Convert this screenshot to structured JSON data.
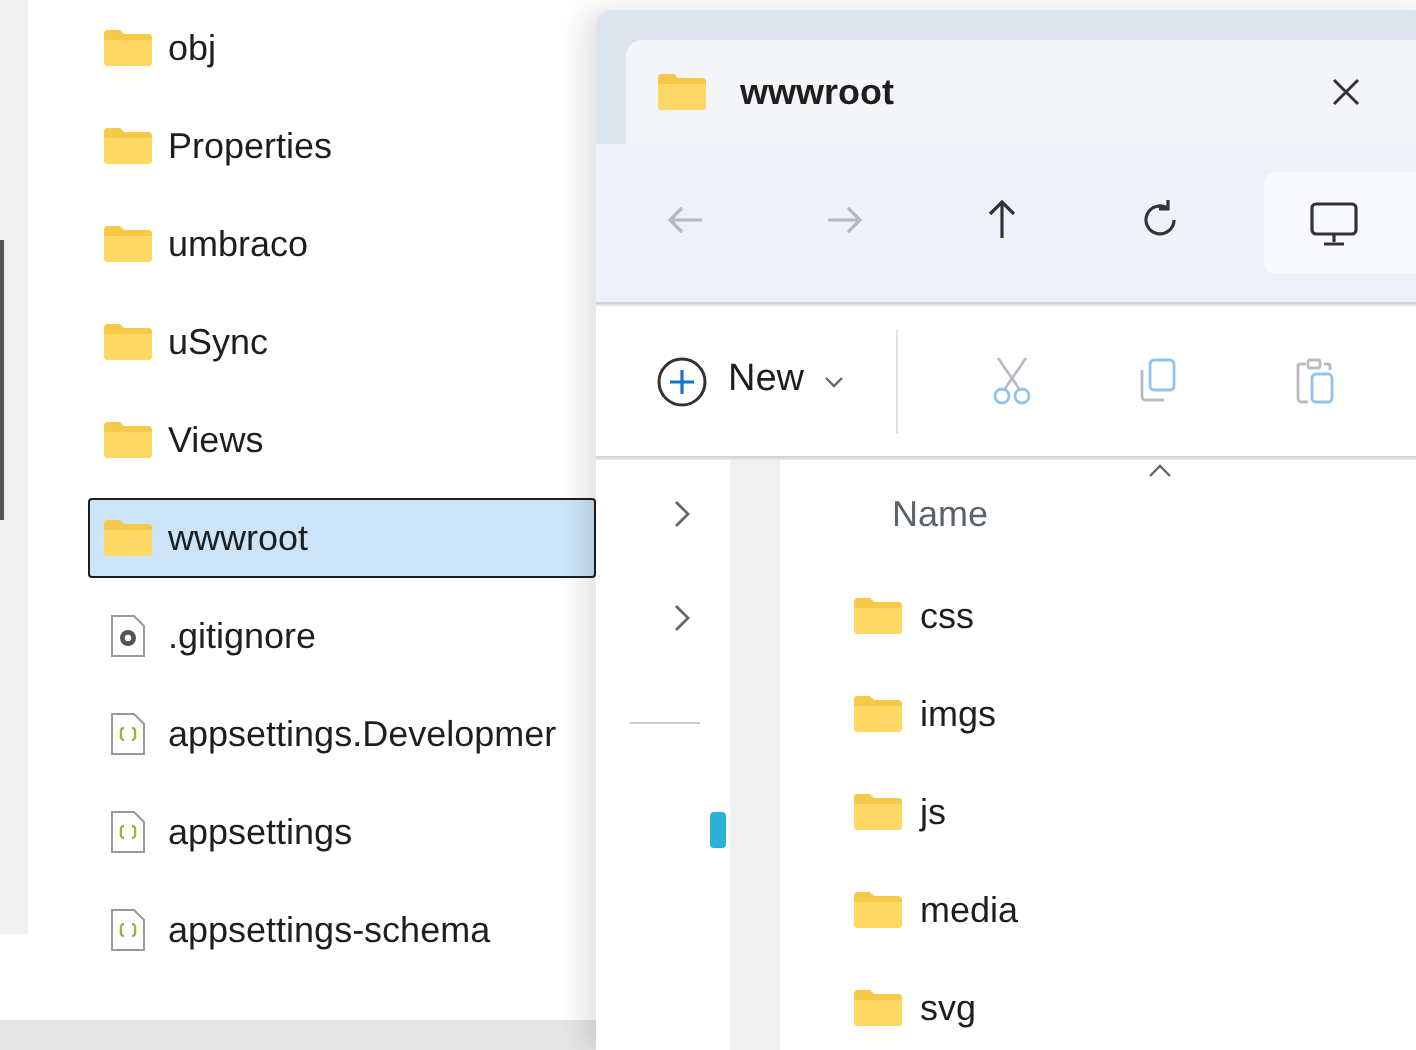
{
  "solution_explorer": {
    "items": [
      {
        "label": "obj",
        "kind": "folder",
        "selected": false
      },
      {
        "label": "Properties",
        "kind": "folder",
        "selected": false
      },
      {
        "label": "umbraco",
        "kind": "folder",
        "selected": false
      },
      {
        "label": "uSync",
        "kind": "folder",
        "selected": false
      },
      {
        "label": "Views",
        "kind": "folder",
        "selected": false
      },
      {
        "label": "wwwroot",
        "kind": "folder",
        "selected": true
      },
      {
        "label": ".gitignore",
        "kind": "config",
        "selected": false
      },
      {
        "label": "appsettings.Developmer",
        "kind": "json",
        "selected": false
      },
      {
        "label": "appsettings",
        "kind": "json",
        "selected": false
      },
      {
        "label": "appsettings-schema",
        "kind": "json",
        "selected": false
      }
    ]
  },
  "explorer": {
    "tab": {
      "title": "wwwroot"
    },
    "nav_buttons": [
      {
        "kind": "back",
        "disabled": true
      },
      {
        "kind": "forward",
        "disabled": true
      },
      {
        "kind": "up",
        "disabled": false
      },
      {
        "kind": "refresh",
        "disabled": false
      }
    ],
    "command_bar": {
      "new_label": "New",
      "tools": [
        {
          "kind": "cut",
          "disabled": true
        },
        {
          "kind": "copy",
          "disabled": true
        },
        {
          "kind": "paste",
          "disabled": true
        }
      ]
    },
    "nav_pane": {
      "nodes": [
        {
          "expanded": false
        },
        {
          "expanded": false
        }
      ]
    },
    "column": "Name",
    "files": [
      {
        "name": "css"
      },
      {
        "name": "imgs"
      },
      {
        "name": "js"
      },
      {
        "name": "media"
      },
      {
        "name": "svg"
      }
    ]
  }
}
